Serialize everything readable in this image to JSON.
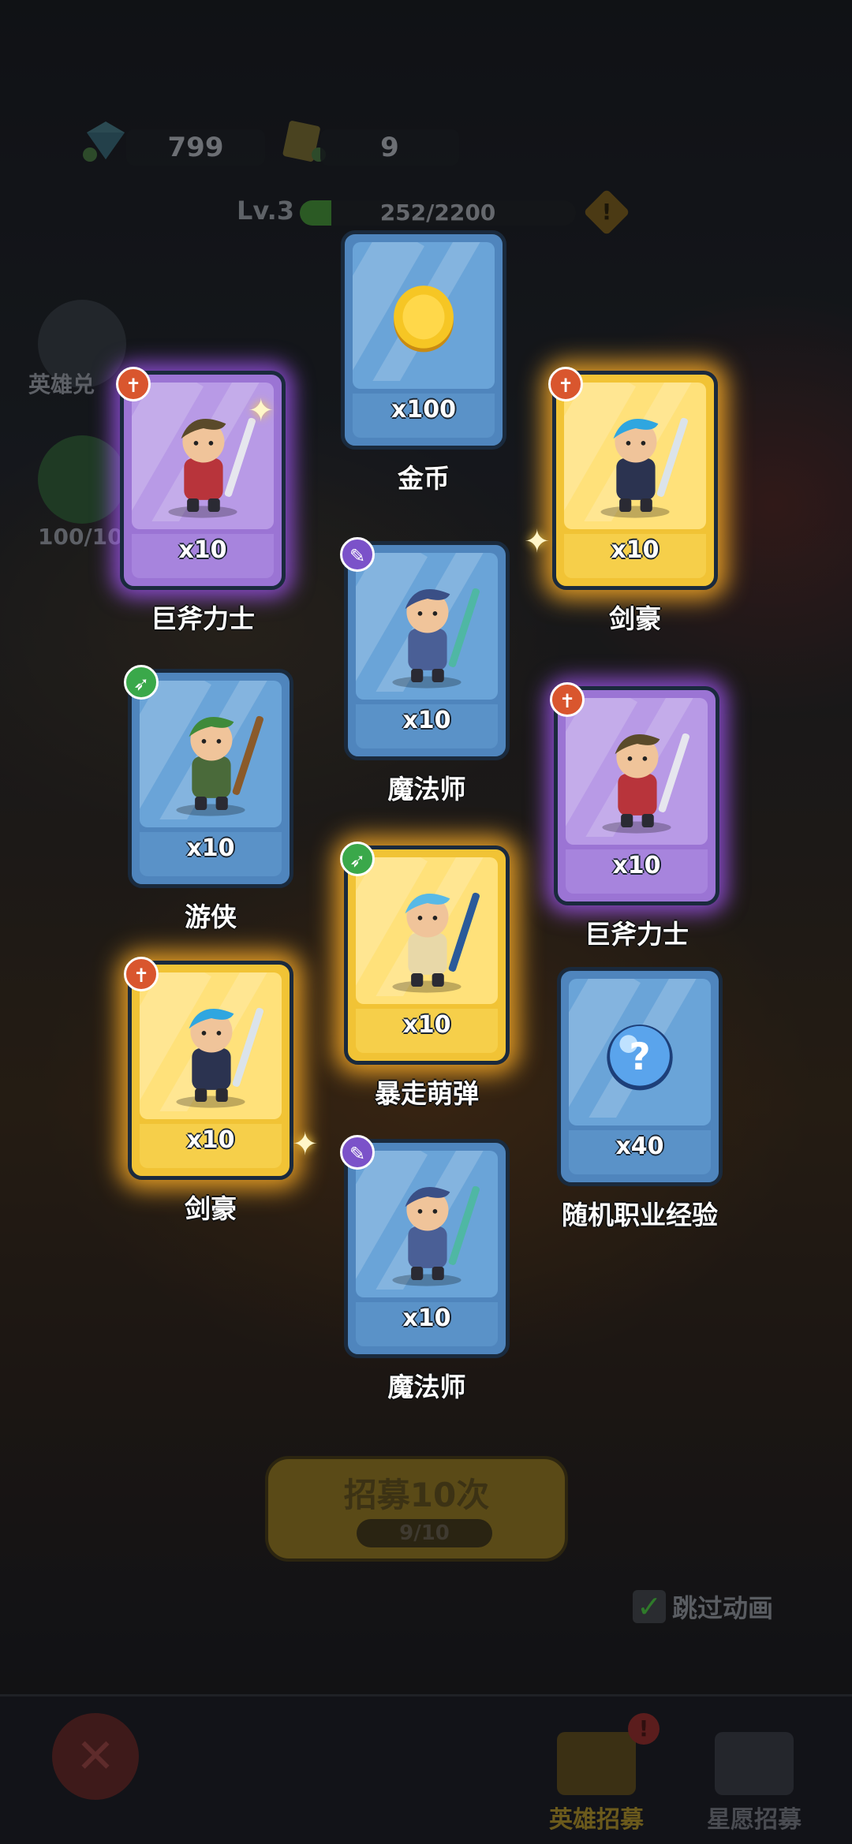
{
  "resources": {
    "gems": "799",
    "tickets": "9"
  },
  "level": {
    "label": "Lv.3",
    "progress": "252/2200",
    "progress_fraction": 0.115
  },
  "side": {
    "hero_exchange_label": "英雄兑",
    "counter_label": "100/10"
  },
  "cards": [
    {
      "name": "金币",
      "qty": "x100",
      "rarity": "blue",
      "item": "gold-coin"
    },
    {
      "name": "巨斧力士",
      "qty": "x10",
      "rarity": "purple",
      "class": "warrior",
      "item": "axe-hero"
    },
    {
      "name": "剑豪",
      "qty": "x10",
      "rarity": "gold",
      "class": "warrior",
      "item": "swordsman-hero"
    },
    {
      "name": "魔法师",
      "qty": "x10",
      "rarity": "blue",
      "class": "mage",
      "item": "wizard-hero"
    },
    {
      "name": "游侠",
      "qty": "x10",
      "rarity": "blue",
      "class": "ranger",
      "item": "ranger-hero"
    },
    {
      "name": "巨斧力士",
      "qty": "x10",
      "rarity": "purple",
      "class": "warrior",
      "item": "axe-hero"
    },
    {
      "name": "暴走萌弹",
      "qty": "x10",
      "rarity": "gold",
      "class": "ranger",
      "item": "gunner-hero"
    },
    {
      "name": "剑豪",
      "qty": "x10",
      "rarity": "gold",
      "class": "warrior",
      "item": "swordsman-hero"
    },
    {
      "name": "随机职业经验",
      "qty": "x40",
      "rarity": "blue",
      "item": "random-exp-orb"
    },
    {
      "name": "魔法师",
      "qty": "x10",
      "rarity": "blue",
      "class": "mage",
      "item": "wizard-hero"
    }
  ],
  "recruit": {
    "label": "招募10次",
    "count": "9/10"
  },
  "skip_animation": {
    "label": "跳过动画",
    "checked": true
  },
  "nav": {
    "hero_recruit": "英雄招募",
    "wish_recruit": "星愿招募"
  },
  "colors": {
    "blue": "#4f85bd",
    "purple": "#9b74d4",
    "gold": "#f1c335",
    "active_nav": "#6b5a1c"
  }
}
